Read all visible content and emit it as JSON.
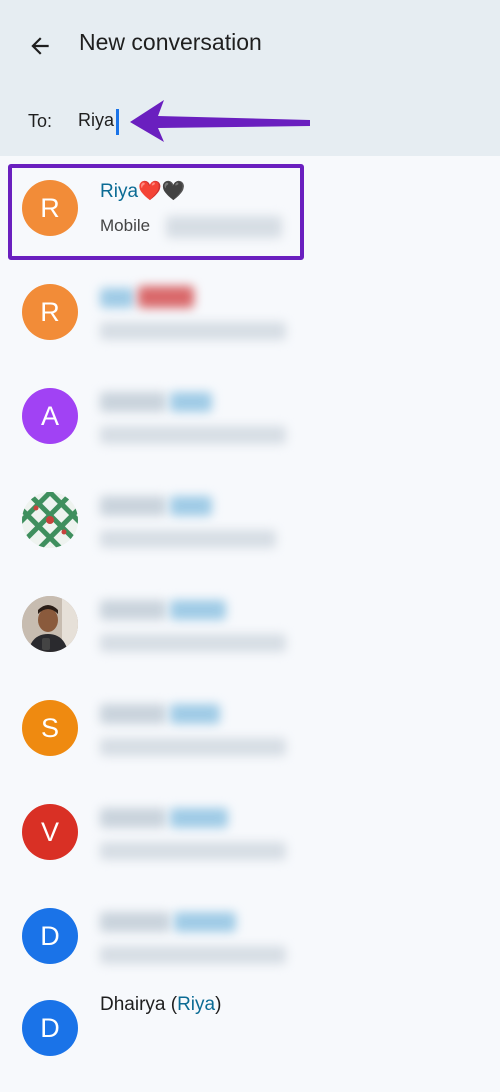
{
  "header": {
    "title": "New conversation",
    "to_label": "To:",
    "to_value": "Riya"
  },
  "contacts": [
    {
      "initial": "R",
      "name": "Riya",
      "emoji": "❤️🖤",
      "phone_label": "Mobile",
      "avatar_color": "#f28c38"
    },
    {
      "initial": "R",
      "avatar_color": "#f28c38"
    },
    {
      "initial": "A",
      "avatar_color": "#a142f4"
    },
    {
      "avatar_kind": "pattern"
    },
    {
      "avatar_kind": "photo"
    },
    {
      "initial": "S",
      "avatar_color": "#ef8a10"
    },
    {
      "initial": "V",
      "avatar_color": "#d93025"
    },
    {
      "initial": "D",
      "avatar_color": "#1a73e8"
    },
    {
      "initial": "D",
      "avatar_color": "#1a73e8",
      "name_prefix": "Dhairya (",
      "name_match": "Riya",
      "name_suffix": ")"
    }
  ],
  "colors": {
    "accent_highlight": "#6a1fbf",
    "match_text": "#0b6b94",
    "header_bg": "#e6edf2",
    "list_bg": "#f7f9fc"
  }
}
